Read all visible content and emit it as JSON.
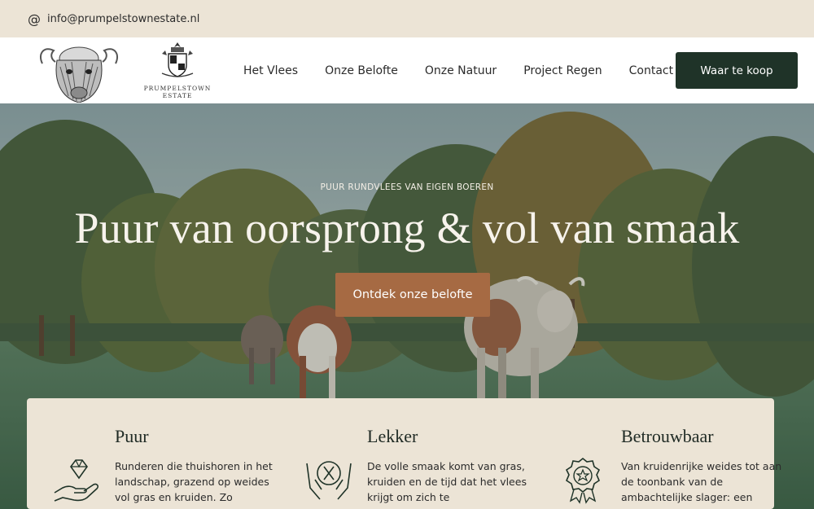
{
  "topbar": {
    "email": "info@prumpelstownestate.nl",
    "at_icon": "@"
  },
  "brand": {
    "line1": "PRUMPELSTOWN",
    "line2": "ESTATE"
  },
  "nav": {
    "items": [
      {
        "label": "Het Vlees"
      },
      {
        "label": "Onze Belofte"
      },
      {
        "label": "Onze Natuur"
      },
      {
        "label": "Project Regen"
      },
      {
        "label": "Contact"
      }
    ],
    "cta_label": "Waar te koop"
  },
  "hero": {
    "kicker": "PUUR RUNDVLEES VAN EIGEN BOEREN",
    "headline": "Puur van oorsprong & vol van smaak",
    "button_label": "Ontdek onze belofte"
  },
  "features": [
    {
      "title": "Puur",
      "text": "Runderen die thuishoren in het landschap, grazend op weides vol gras en kruiden. Zo",
      "icon": "diamond-hand-icon"
    },
    {
      "title": "Lekker",
      "text": "De volle smaak komt van gras, kruiden en de tijd dat het vlees krijgt om zich te",
      "icon": "cutlery-hands-icon"
    },
    {
      "title": "Betrouwbaar",
      "text": "Van kruidenrijke weides tot aan de toonbank van de ambachtelijke slager: een",
      "icon": "award-badge-icon"
    }
  ],
  "colors": {
    "accent_dark": "#1f3328",
    "accent_copper": "#a66a43",
    "sand": "#ece4d6"
  }
}
